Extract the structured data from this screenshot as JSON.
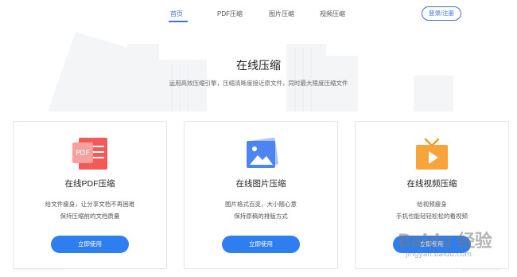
{
  "nav": {
    "items": [
      {
        "label": "首页",
        "active": true
      },
      {
        "label": "PDF压缩",
        "active": false
      },
      {
        "label": "图片压缩",
        "active": false
      },
      {
        "label": "视频压缩",
        "active": false
      }
    ],
    "login_label": "登录/注册"
  },
  "hero": {
    "title": "在线压缩",
    "subtitle": "运用高效压缩引擎，压缩清晰度接近原文件，同时最大限度压缩文件"
  },
  "cards": [
    {
      "title": "在线PDF压缩",
      "desc_line1": "给文件瘦身，让分享文档不再困难",
      "desc_line2": "保持压缩前的文档质量",
      "button": "立即使用",
      "icon_label": "PDF",
      "icon": "pdf-icon",
      "color": "#f06262"
    },
    {
      "title": "在线图片压缩",
      "desc_line1": "图片格式百变，大小随心意",
      "desc_line2": "保持原稿的排版方式",
      "button": "立即使用",
      "icon": "image-icon",
      "color": "#4c84f0"
    },
    {
      "title": "在线视频压缩",
      "desc_line1": "给视频瘦身",
      "desc_line2": "手机也能轻轻松松的看视频",
      "button": "立即使用",
      "icon": "video-icon",
      "color": "#f7a43c"
    }
  ],
  "watermark": {
    "text": "Baidu 经验",
    "url": "jingyan.baidu.com"
  },
  "colors": {
    "accent": "#3f6fe0",
    "button": "#2f7ef0"
  }
}
